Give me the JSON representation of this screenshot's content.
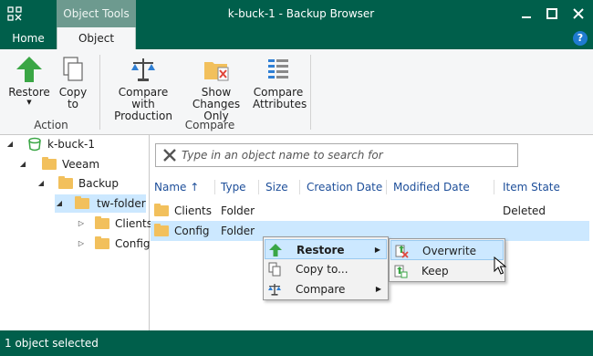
{
  "titlebar": {
    "context_tab": "Object Tools",
    "title": "k-buck-1 - Backup Browser"
  },
  "tabs": {
    "home": "Home",
    "object": "Object"
  },
  "ribbon": {
    "restore": "Restore",
    "copy_line1": "Copy",
    "copy_line2": "to",
    "compare_prod_line1": "Compare with",
    "compare_prod_line2": "Production",
    "show_changes_line1": "Show",
    "show_changes_line2": "Changes Only",
    "compare_attr_line1": "Compare",
    "compare_attr_line2": "Attributes",
    "group_action": "Action",
    "group_compare": "Compare"
  },
  "tree": {
    "root": "k-buck-1",
    "veeam": "Veeam",
    "backup": "Backup",
    "tw_folder": "tw-folder",
    "clients": "Clients",
    "config": "Config"
  },
  "search": {
    "placeholder": "Type in an object name to search for"
  },
  "columns": {
    "name": "Name",
    "sort_indicator": "↑",
    "type": "Type",
    "size": "Size",
    "creation_date": "Creation Date",
    "modified_date": "Modified Date",
    "item_state": "Item State"
  },
  "rows": [
    {
      "name": "Clients",
      "type": "Folder",
      "state": "Deleted"
    },
    {
      "name": "Config",
      "type": "Folder",
      "state": ""
    }
  ],
  "context_menu": {
    "restore": "Restore",
    "copy_to": "Copy to...",
    "compare": "Compare"
  },
  "submenu": {
    "overwrite": "Overwrite",
    "keep": "Keep"
  },
  "status": {
    "text": "1 object selected"
  },
  "colors": {
    "brand_green": "#005f4b",
    "selection": "#cce8ff",
    "folder": "#f2c05c"
  }
}
